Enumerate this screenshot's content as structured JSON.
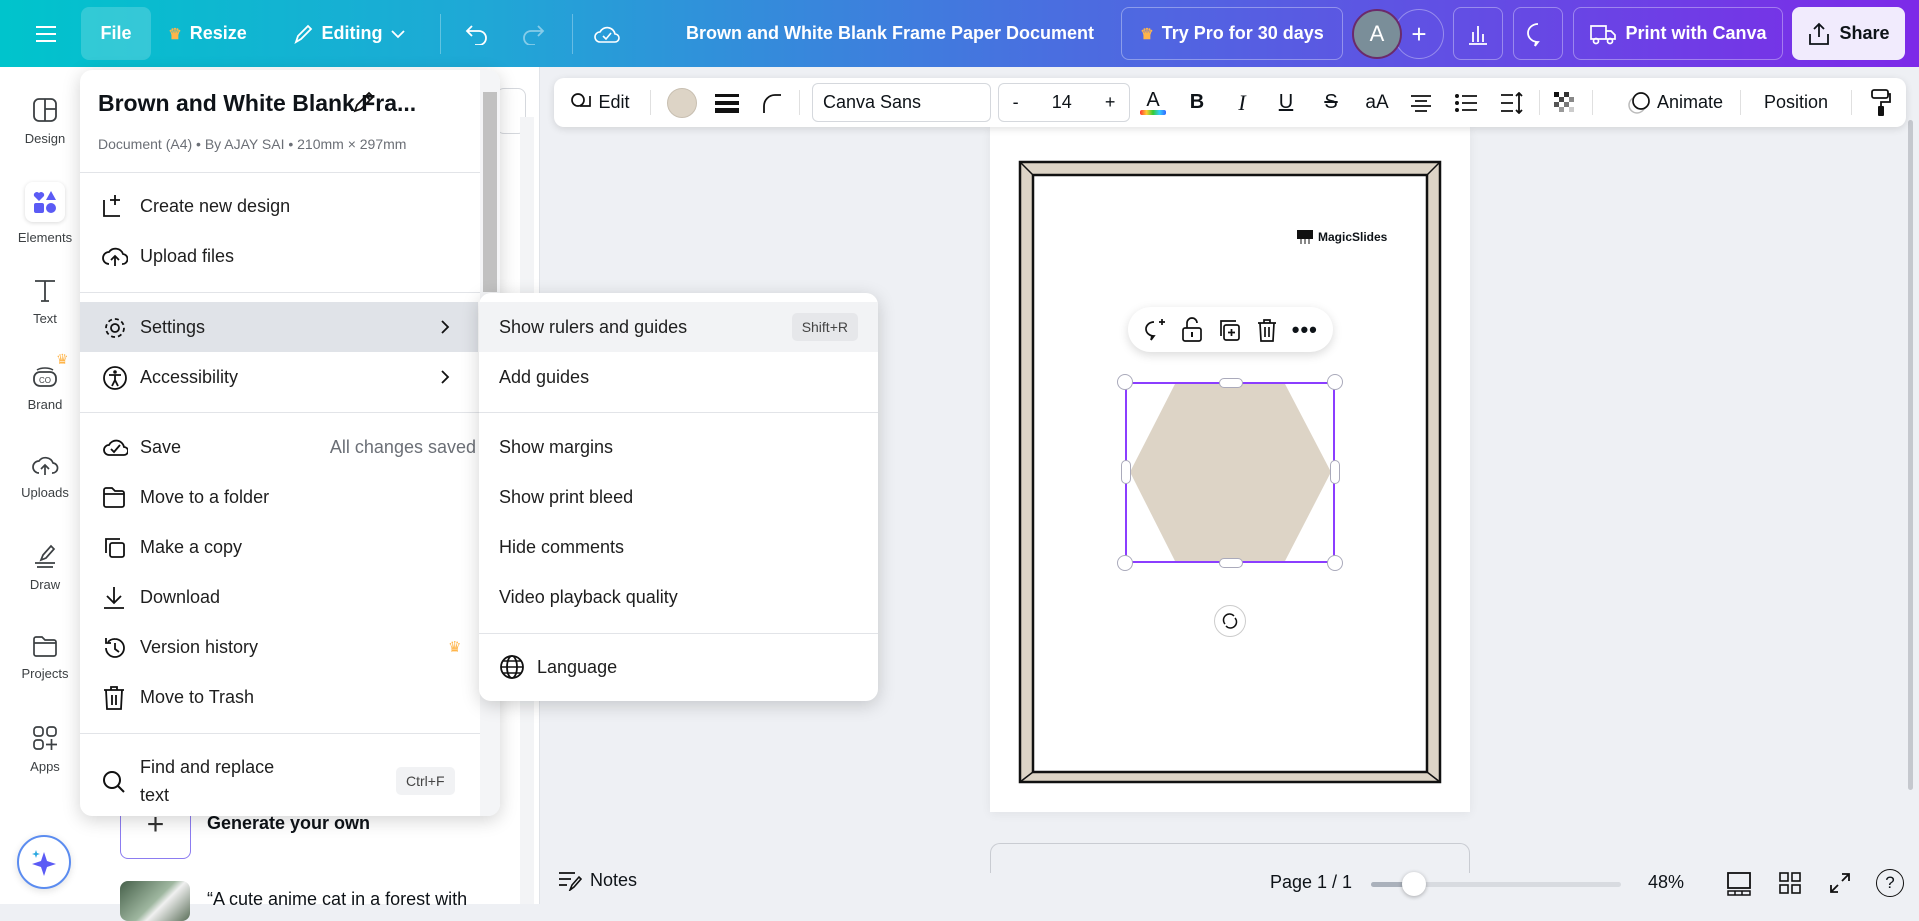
{
  "topbar": {
    "file": "File",
    "resize": "Resize",
    "editing": "Editing",
    "doc_title": "Brown and White Blank Frame Paper Document",
    "try_pro": "Try Pro for 30 days",
    "avatar_initial": "A",
    "print": "Print with Canva",
    "share": "Share"
  },
  "sidebar": {
    "items": [
      {
        "label": "Design"
      },
      {
        "label": "Elements"
      },
      {
        "label": "Text"
      },
      {
        "label": "Brand"
      },
      {
        "label": "Uploads"
      },
      {
        "label": "Draw"
      },
      {
        "label": "Projects"
      },
      {
        "label": "Apps"
      }
    ]
  },
  "panel": {
    "generate": "Generate your own",
    "prompt": "“A cute anime cat in a forest with"
  },
  "toolbar": {
    "edit": "Edit",
    "font": "Canva Sans",
    "minus": "-",
    "font_size": "14",
    "plus": "+",
    "text_color": "A",
    "bold": "B",
    "italic": "I",
    "underline": "U",
    "strike": "S",
    "case": "aA",
    "animate": "Animate",
    "position": "Position",
    "shape_color": "#ddd4c6"
  },
  "file_menu": {
    "title": "Brown and White Blank Fra...",
    "meta": "Document (A4) • By AJAY SAI • 210mm × 297mm",
    "items": [
      {
        "label": "Create new design"
      },
      {
        "label": "Upload files"
      },
      {
        "label": "Settings"
      },
      {
        "label": "Accessibility"
      },
      {
        "label": "Save",
        "hint": "All changes saved"
      },
      {
        "label": "Move to a folder"
      },
      {
        "label": "Make a copy"
      },
      {
        "label": "Download"
      },
      {
        "label": "Version history"
      },
      {
        "label": "Move to Trash"
      },
      {
        "label": "Find and replace text",
        "shortcut": "Ctrl+F"
      }
    ]
  },
  "settings_menu": {
    "items": [
      {
        "label": "Show rulers and guides",
        "shortcut": "Shift+R"
      },
      {
        "label": "Add guides"
      },
      {
        "label": "Show margins"
      },
      {
        "label": "Show print bleed"
      },
      {
        "label": "Hide comments"
      },
      {
        "label": "Video playback quality"
      },
      {
        "label": "Language"
      }
    ]
  },
  "canvas": {
    "logo_text": "MagicSlides"
  },
  "footer": {
    "notes": "Notes",
    "page": "Page 1 / 1",
    "zoom": "48%",
    "zoom_value": 48
  }
}
